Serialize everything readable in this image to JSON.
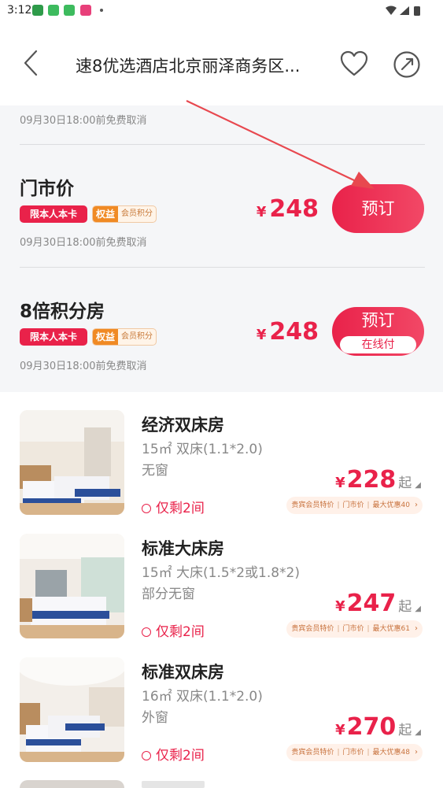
{
  "status_bar": {
    "time": "3:12",
    "icons": [
      "notification-app-icon",
      "app-icon-kan",
      "app-icon-kan-2",
      "app-icon-pink"
    ]
  },
  "header": {
    "title": "速8优选酒店北京丽泽商务区...",
    "icons": [
      "back-icon",
      "heart-icon",
      "share-icon"
    ]
  },
  "rates": {
    "top_cancel": "09月30日18:00前免费取消",
    "items": [
      {
        "name": "门市价",
        "tag_card": "限本人本卡",
        "tag_perk_a": "权益",
        "tag_perk_b": "会员积分",
        "currency": "¥",
        "price": "248",
        "button": "预订",
        "button_sub": "",
        "cancel": "09月30日18:00前免费取消"
      },
      {
        "name": "8倍积分房",
        "tag_card": "限本人本卡",
        "tag_perk_a": "权益",
        "tag_perk_b": "会员积分",
        "currency": "¥",
        "price": "248",
        "button": "预订",
        "button_sub": "在线付",
        "cancel": "09月30日18:00前免费取消"
      }
    ]
  },
  "rooms": [
    {
      "name": "经济双床房",
      "spec": "15㎡  双床(1.1*2.0)",
      "window": "无窗",
      "remain": "仅剩2间",
      "currency": "¥",
      "price": "228",
      "suffix": "起",
      "tag1": "贵宾会员特价",
      "tag2": "门市价",
      "tag3": "最大优惠40"
    },
    {
      "name": "标准大床房",
      "spec": "15㎡  大床(1.5*2或1.8*2)",
      "window": "部分无窗",
      "remain": "仅剩2间",
      "currency": "¥",
      "price": "247",
      "suffix": "起",
      "tag1": "贵宾会员特价",
      "tag2": "门市价",
      "tag3": "最大优惠61"
    },
    {
      "name": "标准双床房",
      "spec": "16㎡  双床(1.1*2.0)",
      "window": "外窗",
      "remain": "仅剩2间",
      "currency": "¥",
      "price": "270",
      "suffix": "起",
      "tag1": "贵宾会员特价",
      "tag2": "门市价",
      "tag3": "最大优惠48"
    }
  ],
  "colors": {
    "accent": "#e9224a",
    "annotation_arrow": "#e8484f",
    "perk_orange": "#f08a24"
  }
}
